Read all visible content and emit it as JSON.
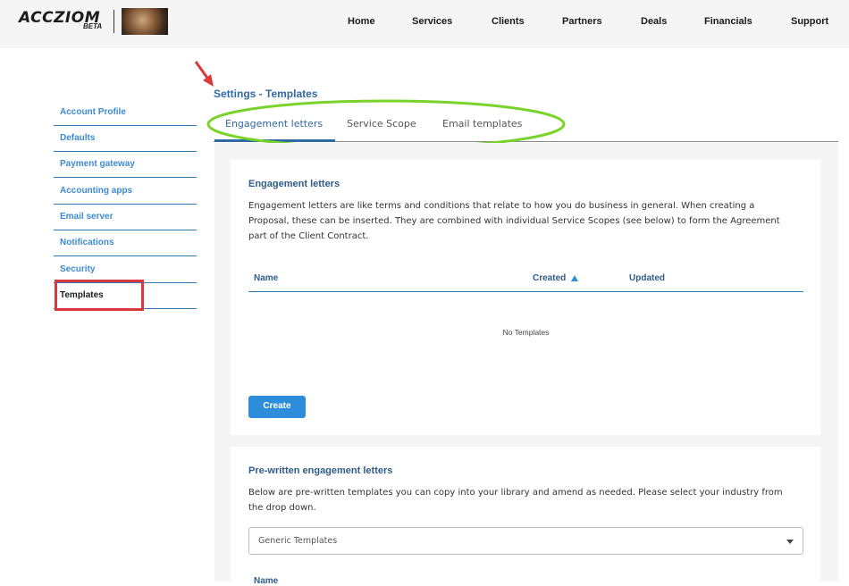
{
  "header": {
    "logo_text": "ACCZIOM",
    "logo_sub": "BETA",
    "nav": [
      "Home",
      "Services",
      "Clients",
      "Partners",
      "Deals",
      "Financials",
      "Support"
    ]
  },
  "sidebar": {
    "items": [
      {
        "label": "Account Profile"
      },
      {
        "label": "Defaults"
      },
      {
        "label": "Payment gateway"
      },
      {
        "label": "Accounting apps"
      },
      {
        "label": "Email server"
      },
      {
        "label": "Notifications"
      },
      {
        "label": "Security"
      },
      {
        "label": "Templates",
        "active": true
      }
    ]
  },
  "page": {
    "title": "Settings - Templates",
    "tabs": [
      "Engagement letters",
      "Service Scope",
      "Email templates"
    ],
    "active_tab": "Engagement letters"
  },
  "engagement": {
    "title": "Engagement letters",
    "description": "Engagement letters are like terms and conditions that relate to how you do business in general. When creating a Proposal, these can be inserted. They are combined with individual Service Scopes (see below) to form the Agreement part of the Client Contract.",
    "columns": [
      "Name",
      "Created",
      "Updated"
    ],
    "empty_text": "No Templates",
    "create_label": "Create"
  },
  "prewritten": {
    "title": "Pre-written engagement letters",
    "description": "Below are pre-written templates you can copy into your library and amend as needed. Please select your industry from the drop down.",
    "select_value": "Generic Templates",
    "column": "Name"
  },
  "colors": {
    "accent": "#2e8ddb",
    "title_blue": "#2f6aa3",
    "annotation_green": "#79d32a",
    "annotation_red": "#d9383d"
  }
}
